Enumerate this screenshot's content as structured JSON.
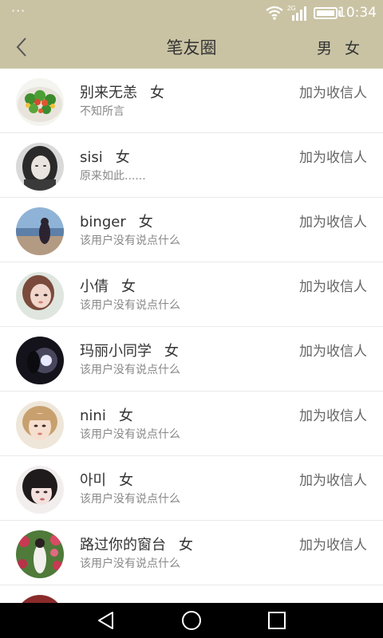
{
  "status": {
    "dots": "···",
    "network": "2G",
    "time": "10:34"
  },
  "header": {
    "title": "笔友圈",
    "male": "男",
    "female": "女"
  },
  "accent_color": "#c9c3a4",
  "contacts": [
    {
      "name": "别来无恙",
      "gender": "女",
      "sub": "不知所言",
      "action": "加为收信人"
    },
    {
      "name": "sisi",
      "gender": "女",
      "sub": "原来如此......",
      "action": "加为收信人"
    },
    {
      "name": "binger",
      "gender": "女",
      "sub": "该用户没有说点什么",
      "action": "加为收信人"
    },
    {
      "name": "小倩",
      "gender": "女",
      "sub": "该用户没有说点什么",
      "action": "加为收信人"
    },
    {
      "name": "玛丽小同学",
      "gender": "女",
      "sub": "该用户没有说点什么",
      "action": "加为收信人"
    },
    {
      "name": "nini",
      "gender": "女",
      "sub": "该用户没有说点什么",
      "action": "加为收信人"
    },
    {
      "name": "아미",
      "gender": "女",
      "sub": "该用户没有说点什么",
      "action": "加为收信人"
    },
    {
      "name": "路过你的窗台",
      "gender": "女",
      "sub": "该用户没有说点什么",
      "action": "加为收信人"
    }
  ]
}
